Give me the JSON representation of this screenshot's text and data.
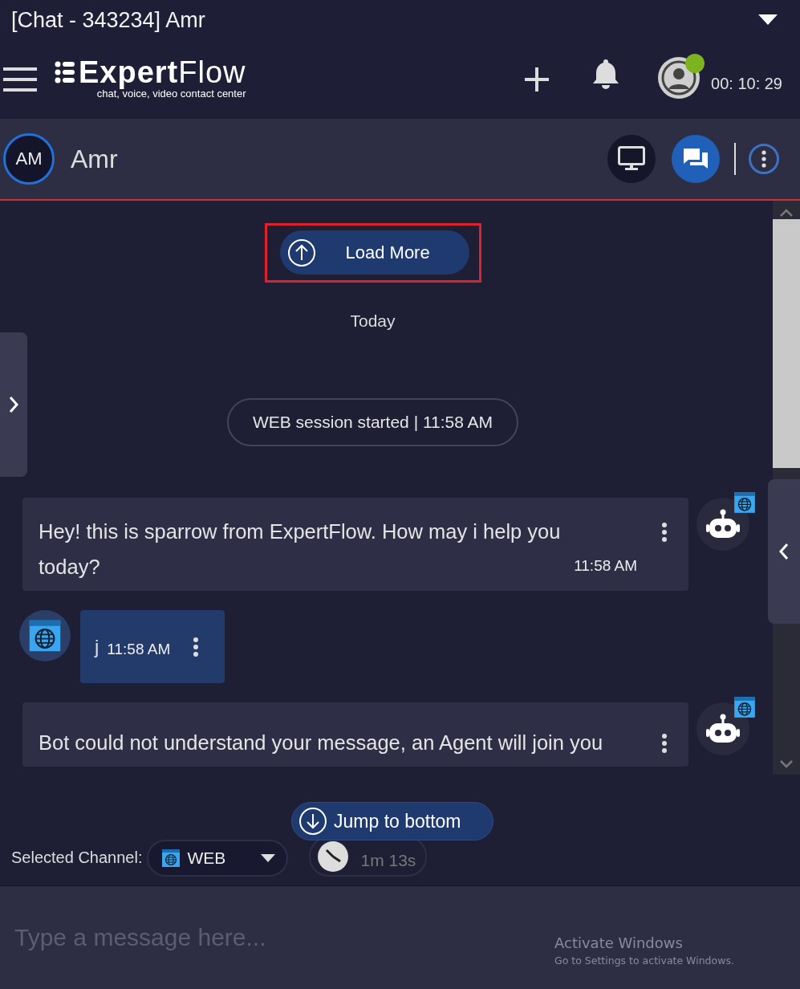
{
  "window": {
    "title": "[Chat - 343234] Amr"
  },
  "header": {
    "logo": "**Expert**Flow",
    "tagline": "chat, voice, video contact center",
    "timer": "00: 10: 29",
    "online": true
  },
  "contact": {
    "initials": "AM",
    "name": "Amr"
  },
  "views": [
    {
      "kind": "screen",
      "selected": false
    },
    {
      "kind": "chat",
      "selected": true
    }
  ],
  "conversation": {
    "load_more": "Load More",
    "load_more_highlighted": true,
    "date": "Today",
    "session_notice": "WEB session started | 11:58 AM",
    "messages": [
      {
        "kind": "bot",
        "text": "Hey! this is sparrow from ExpertFlow. How may i help you today?",
        "time": "11:58 AM"
      },
      {
        "kind": "customer",
        "text": "j",
        "time": "11:58 AM"
      },
      {
        "kind": "bot",
        "text": "Bot could not understand your message, an Agent will join you"
      }
    ]
  },
  "jump_button": "Jump to bottom",
  "channel": {
    "label": "Selected Channel:",
    "value": "WEB"
  },
  "duration": "1m 13s",
  "composer": {
    "placeholder": "Type a message here..."
  },
  "os_notice": {
    "title": "Activate Windows",
    "subtitle": "Go to Settings to activate Windows."
  }
}
